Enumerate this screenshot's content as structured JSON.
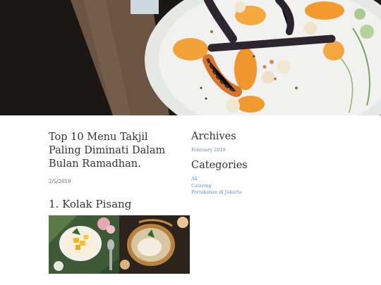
{
  "post": {
    "title": "Top 10 Menu Takjil Paling Diminati Dalam Bulan Ramadhan.",
    "date": "2/5/2019",
    "section_heading": "1. Kolak Pisang"
  },
  "sidebar": {
    "archives_title": "Archives",
    "archives": [
      "February 2019"
    ],
    "categories_title": "Categories",
    "categories": [
      "All",
      "Catering",
      "Pernikahan di Jakarta"
    ]
  },
  "colors": {
    "link": "#5b8fc7",
    "heading": "#333333"
  }
}
